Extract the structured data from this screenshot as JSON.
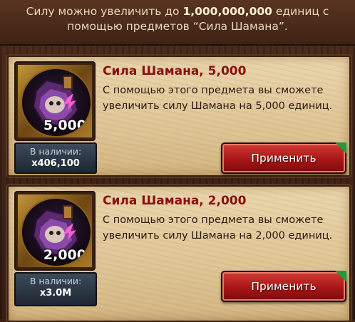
{
  "header": {
    "line1_prefix": "Силу можно увеличить до",
    "line1_amount": "1,000,000,000",
    "line1_suffix": "единиц с",
    "line2": "помощью предметов “Сила Шамана”."
  },
  "items": [
    {
      "title": "Сила Шамана, 5,000",
      "description": "С помощью этого предмета вы сможете увеличить силу Шамана на 5,000 единиц.",
      "icon_quantity": "5,000",
      "stock_label": "В наличии:",
      "stock_value": "x406,100",
      "button_label": "Применить"
    },
    {
      "title": "Сила Шамана, 2,000",
      "description": "С помощью этого предмета вы сможете увеличить силу Шамана на 2,000 единиц.",
      "icon_quantity": "2,000",
      "stock_label": "В наличии:",
      "stock_value": "x3.0M",
      "button_label": "Применить"
    }
  ],
  "colors": {
    "title": "#8a0f0f",
    "button": "#a81616",
    "corner_badge": "#1f9b3a"
  },
  "icons": [
    "shaman-potion-icon",
    "corner-badge-icon"
  ]
}
